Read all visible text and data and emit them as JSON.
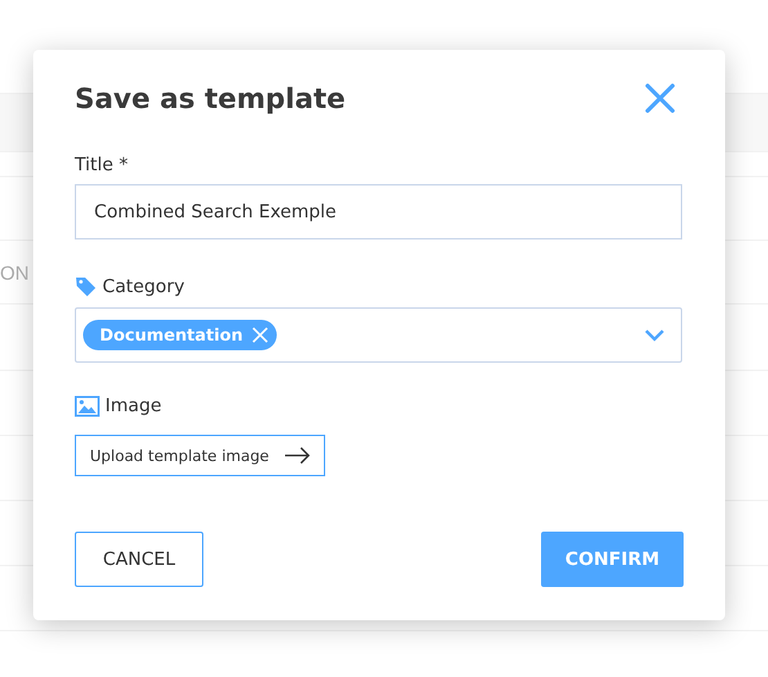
{
  "background": {
    "fragment": "ON"
  },
  "dialog": {
    "title": "Save as template",
    "title_field": {
      "label": "Title *",
      "value": "Combined Search Exemple"
    },
    "category": {
      "label": "Category",
      "chips": [
        {
          "label": "Documentation"
        }
      ]
    },
    "image": {
      "label": "Image",
      "upload_button": "Upload template image"
    },
    "buttons": [
      {
        "label": "CANCEL",
        "kind": "outline"
      },
      {
        "label": "CONFIRM",
        "kind": "primary"
      }
    ]
  }
}
